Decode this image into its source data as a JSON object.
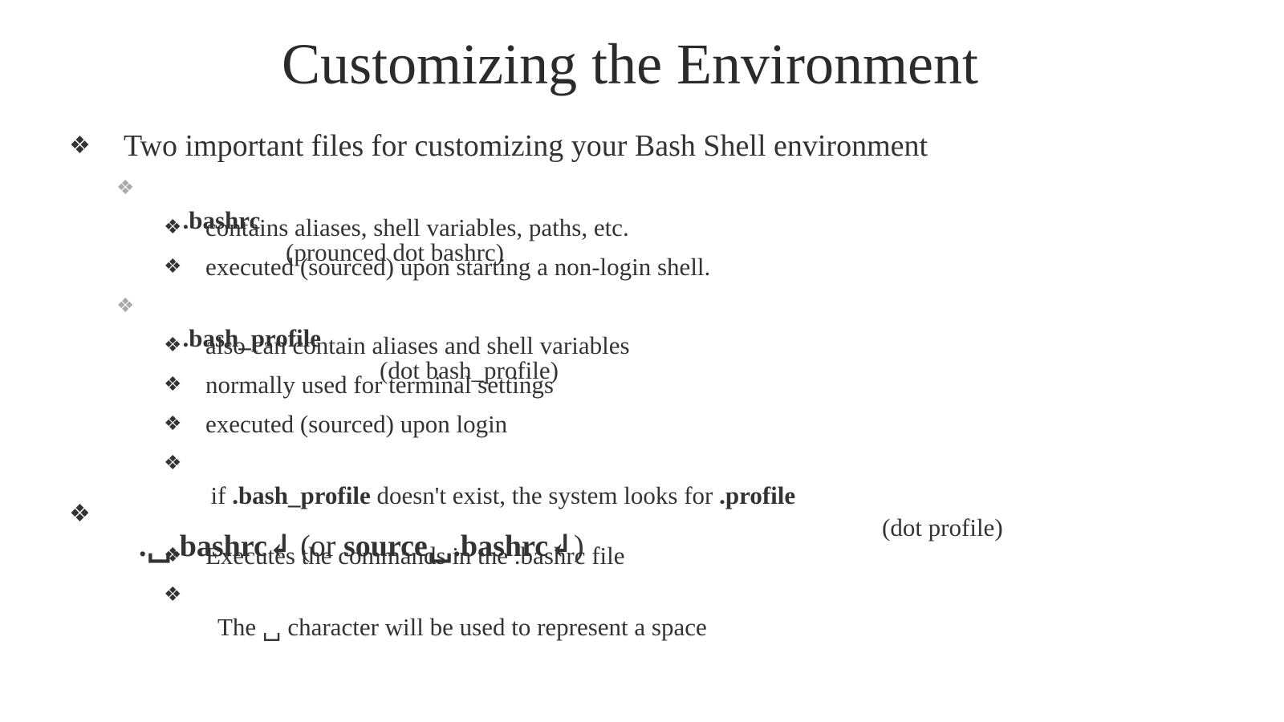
{
  "title": "Customizing the Environment",
  "bullet_glyph": "❖",
  "items": [
    {
      "text": "Two important files for customizing your Bash Shell environment"
    },
    {
      "bold": ".bashrc",
      "text": "(prounced dot bashrc)"
    },
    {
      "text": "contains aliases, shell variables, paths, etc."
    },
    {
      "text": "executed (sourced) upon starting a non-login shell."
    },
    {
      "bold": ".bash_profile",
      "text": "(dot bash_profile)"
    },
    {
      "text": "also can contain aliases and shell variables"
    },
    {
      "text": "normally used for terminal settings"
    },
    {
      "text": "executed (sourced) upon login"
    },
    {
      "t1": "if ",
      "b1": ".bash_profile",
      "t2": " doesn't exist, the system looks for ",
      "b2": ".profile",
      "t3": "(dot profile)"
    },
    {
      "b1": ".␣.bashrc↲",
      "t1": " (or ",
      "b2": "source␣.bashrc↲",
      "t2": ")"
    },
    {
      "text": "Executes the commands in the .bashrc file"
    },
    {
      "t1": "The ",
      "sym": "␣",
      "t2": " character will be used to represent a space"
    }
  ]
}
